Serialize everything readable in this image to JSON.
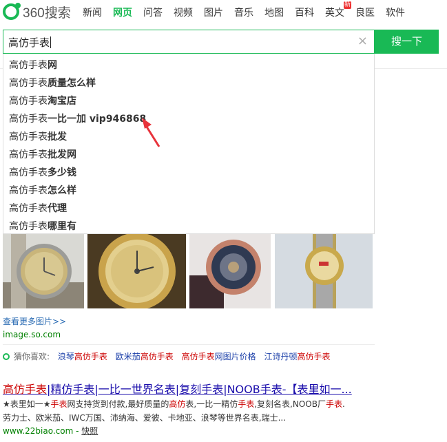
{
  "logo": {
    "text": "360搜索"
  },
  "nav": {
    "items": [
      "新闻",
      "网页",
      "问答",
      "视频",
      "图片",
      "音乐",
      "地图",
      "百科",
      "英文",
      "良医",
      "软件"
    ],
    "active": "网页",
    "badge": "新"
  },
  "search": {
    "value": "高仿手表",
    "button": "搜一下",
    "clear": "×"
  },
  "suggestions": [
    {
      "prefix": "高仿手表",
      "rest": "网"
    },
    {
      "prefix": "高仿手表",
      "rest": "质量怎么样"
    },
    {
      "prefix": "高仿手表",
      "rest": "淘宝店"
    },
    {
      "prefix": "高仿手表",
      "rest": "一比一加 vip946868"
    },
    {
      "prefix": "高仿手表",
      "rest": "批发"
    },
    {
      "prefix": "高仿手表",
      "rest": "批发网"
    },
    {
      "prefix": "高仿手表",
      "rest": "多少钱"
    },
    {
      "prefix": "高仿手表",
      "rest": "怎么样"
    },
    {
      "prefix": "高仿手表",
      "rest": "代理"
    },
    {
      "prefix": "高仿手表",
      "rest": "哪里有"
    }
  ],
  "images": {
    "more": "查看更多图片>>",
    "site": "image.so.com"
  },
  "related": {
    "label": "猜你喜欢:",
    "links": [
      {
        "pre": "浪琴",
        "hl": "高仿手表",
        "post": ""
      },
      {
        "pre": "欧米茄",
        "hl": "高仿手表",
        "post": ""
      },
      {
        "pre": "",
        "hl": "高仿手表",
        "post": "网图片价格"
      },
      {
        "pre": "江诗丹顿",
        "hl": "高仿手表",
        "post": ""
      }
    ]
  },
  "result": {
    "title_hl": "高仿手表",
    "title_rest": "|精仿手表|一比一世界名表|复刻手表|NOOB手表-【表里如一...",
    "desc1_a": "★表里如一★",
    "desc1_b": "手表",
    "desc1_c": "网支持货到付款,最好质量的",
    "desc1_d": "高仿",
    "desc1_e": "表,一比一精仿",
    "desc1_f": "手表",
    "desc1_g": ",复刻名表,NOOB厂",
    "desc1_h": "手表",
    "desc1_i": ".",
    "desc2": "劳力士、欧米茄、IWC万国、沛纳海、爱彼、卡地亚、浪琴等世界名表,瑞士...",
    "url": "www.22biao.com",
    "url_sep": " - ",
    "snapshot": "快照"
  }
}
